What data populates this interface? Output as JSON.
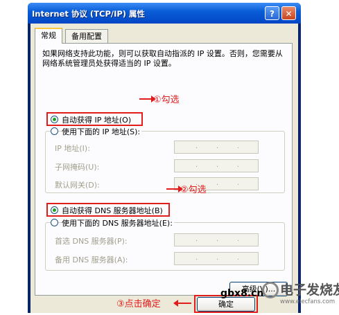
{
  "window": {
    "title": "Internet 协议 (TCP/IP) 属性",
    "help_btn": "?",
    "close_btn": "✕"
  },
  "tabs": [
    {
      "label": "常规"
    },
    {
      "label": "备用配置"
    }
  ],
  "description": "如果网络支持此功能，则可以获取自动指派的 IP 设置。否则，您需要从网络系统管理员处获得适当的 IP 设置。",
  "ip_section": {
    "auto_label": "自动获得 IP 地址(O)",
    "manual_label": "使用下面的 IP 地址(S):",
    "fields": [
      {
        "label": "IP 地址(I):"
      },
      {
        "label": "子网掩码(U):"
      },
      {
        "label": "默认网关(D):"
      }
    ],
    "auto_selected": true
  },
  "dns_section": {
    "auto_label": "自动获得 DNS 服务器地址(B)",
    "manual_label": "使用下面的 DNS 服务器地址(E):",
    "fields": [
      {
        "label": "首选 DNS 服务器(P):"
      },
      {
        "label": "备用 DNS 服务器(A):"
      }
    ],
    "auto_selected": true
  },
  "advanced_button": "高级(V)...",
  "ok_button": "确定",
  "annotations": {
    "step1": "①勾选",
    "step2": "②勾选",
    "step3": "③点击确定"
  },
  "watermark": {
    "site": "gbx8.cn",
    "brand": "电子发烧友",
    "url": "www.elecfans.com"
  },
  "colors": {
    "annotation_red": "#e21b1b",
    "titlebar_blue": "#0a5ed8",
    "dialog_bg": "#ece9d8"
  }
}
